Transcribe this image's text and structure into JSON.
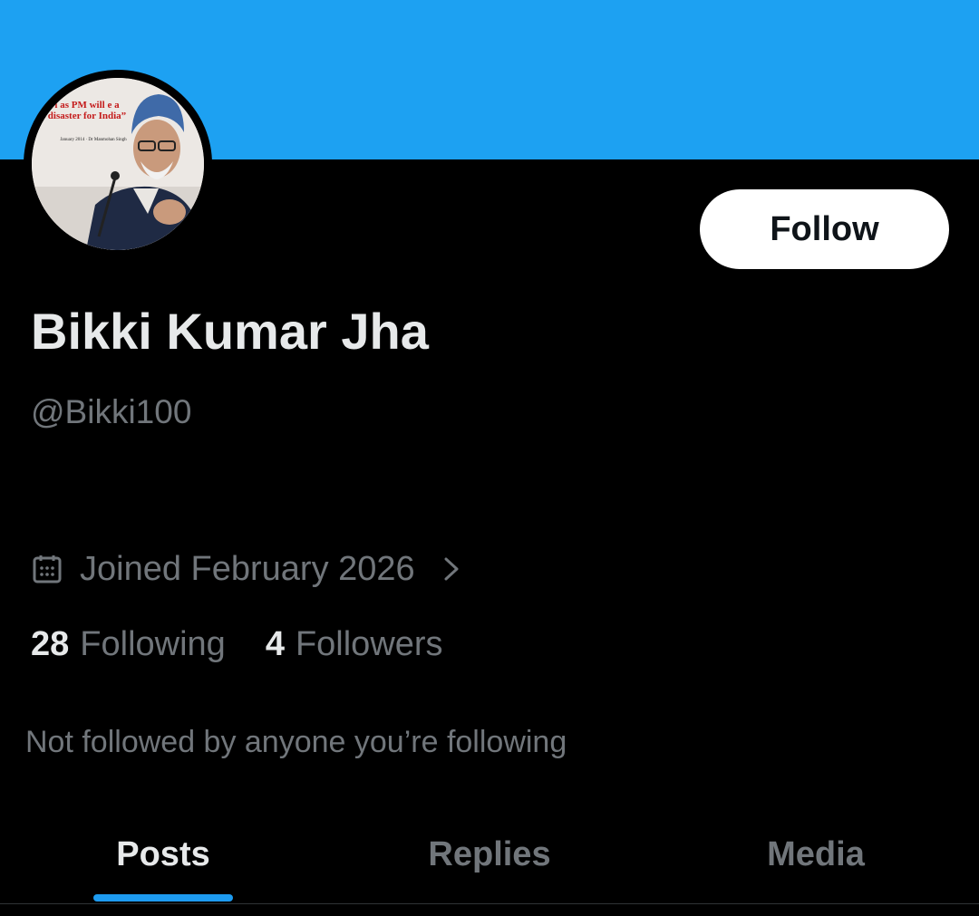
{
  "profile": {
    "display_name": "Bikki Kumar Jha",
    "handle": "@Bikki100",
    "joined": "Joined February 2026",
    "following_count": "28",
    "following_label": "Following",
    "followers_count": "4",
    "followers_label": "Followers",
    "mutuals_text": "Not followed by anyone you’re following",
    "avatar_caption": "i as PM will e a disaster for India”",
    "avatar_meta": "January 2014 · Dr Manmohan Singh"
  },
  "actions": {
    "follow_label": "Follow"
  },
  "tabs": [
    {
      "label": "Posts",
      "active": true
    },
    {
      "label": "Replies",
      "active": false
    },
    {
      "label": "Media",
      "active": false
    }
  ],
  "colors": {
    "banner": "#1da1f2",
    "background": "#000000",
    "primary_text": "#e7e9ea",
    "secondary_text": "#71767b",
    "accent": "#1d9bf0"
  },
  "icons": {
    "joined": "calendar-icon",
    "joined_more": "chevron-right-icon"
  }
}
